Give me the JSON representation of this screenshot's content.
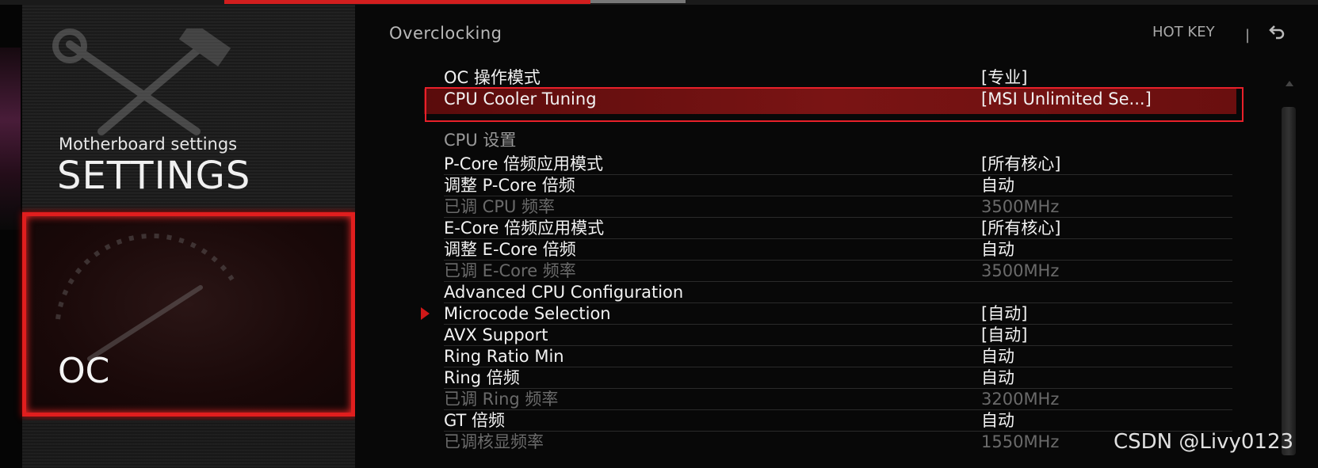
{
  "top_nav": {
    "active_tab_color": "#d21e1e"
  },
  "sidebar": {
    "settings": {
      "subtitle": "Motherboard settings",
      "title": "SETTINGS",
      "icon": "tools-icon"
    },
    "oc": {
      "title": "OC",
      "icon": "gauge-icon",
      "active": true
    }
  },
  "header": {
    "breadcrumb": "Overclocking",
    "hotkey_label": "HOT KEY",
    "divider": "|",
    "back_icon": "back-arrow-icon"
  },
  "settings_list": [
    {
      "label": "OC 操作模式",
      "value": "[专业]",
      "state": "normal"
    },
    {
      "label": "CPU Cooler Tuning",
      "value": "[MSI Unlimited Se...]",
      "state": "selected"
    },
    {
      "label": "CPU  设置",
      "value": "",
      "state": "section"
    },
    {
      "label": "P-Core 倍频应用模式",
      "value": "[所有核心]",
      "state": "normal"
    },
    {
      "label": "调整 P-Core 倍频",
      "value": "自动",
      "state": "normal"
    },
    {
      "label": "已调 CPU 频率",
      "value": "3500MHz",
      "state": "dim"
    },
    {
      "label": "E-Core 倍频应用模式",
      "value": "[所有核心]",
      "state": "normal"
    },
    {
      "label": "调整 E-Core 倍频",
      "value": "自动",
      "state": "normal"
    },
    {
      "label": "已调 E-Core 频率",
      "value": "3500MHz",
      "state": "dim"
    },
    {
      "label": "Advanced CPU Configuration",
      "value": "",
      "state": "submenu"
    },
    {
      "label": "Microcode Selection",
      "value": "[自动]",
      "state": "normal"
    },
    {
      "label": "AVX Support",
      "value": "[自动]",
      "state": "normal"
    },
    {
      "label": "Ring Ratio Min",
      "value": "自动",
      "state": "normal"
    },
    {
      "label": "Ring 倍频",
      "value": "自动",
      "state": "normal"
    },
    {
      "label": "已调 Ring 频率",
      "value": "3200MHz",
      "state": "dim"
    },
    {
      "label": "GT 倍频",
      "value": "自动",
      "state": "normal"
    },
    {
      "label": "已调核显频率",
      "value": "1550MHz",
      "state": "dim"
    }
  ],
  "watermark": "CSDN @Livy0123",
  "colors": {
    "accent": "#e01e1e",
    "selected_row": "#7a1414",
    "text": "#f2f2f2",
    "dim_text": "#6a6a6a"
  }
}
